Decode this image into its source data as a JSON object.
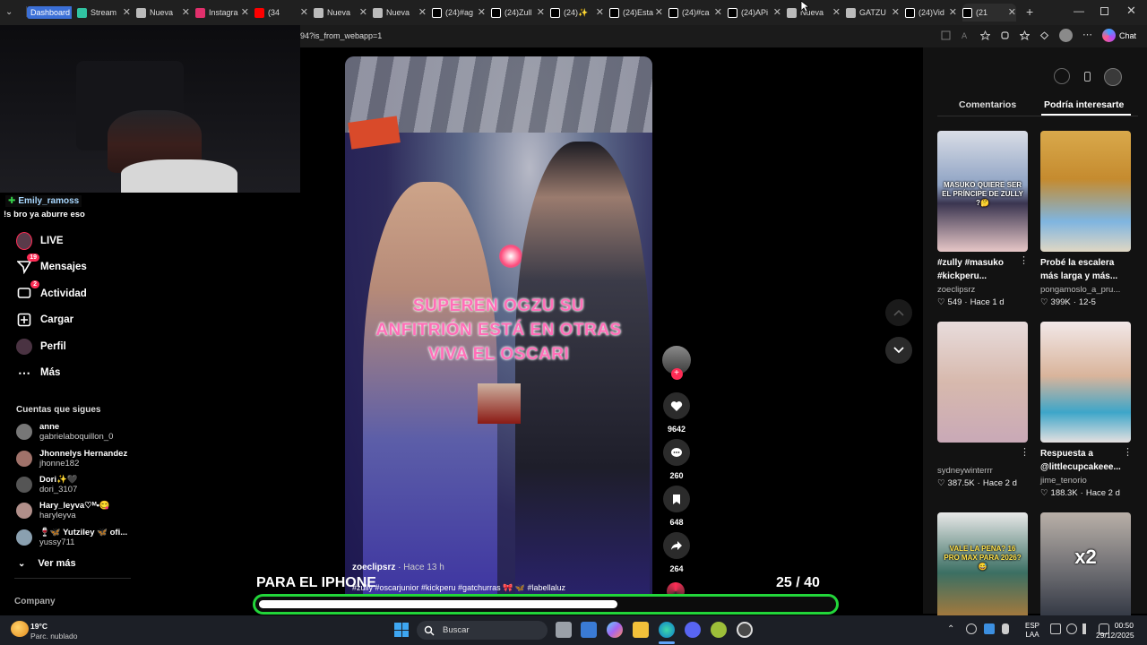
{
  "tabs": [
    {
      "label": "Dashboard",
      "icon": "dashboard-icon"
    },
    {
      "label": "Stream",
      "icon": "streamlabs-icon"
    },
    {
      "label": "Nueva",
      "icon": "page-icon"
    },
    {
      "label": "Instagra",
      "icon": "instagram-icon"
    },
    {
      "label": "(34",
      "icon": "youtube-icon"
    },
    {
      "label": "Nueva",
      "icon": "page-icon"
    },
    {
      "label": "Nueva",
      "icon": "page-icon"
    },
    {
      "label": "(24)#ag",
      "icon": "tiktok-icon"
    },
    {
      "label": "(24)Zull",
      "icon": "tiktok-icon"
    },
    {
      "label": "(24)✨",
      "icon": "tiktok-icon"
    },
    {
      "label": "(24)Esta",
      "icon": "tiktok-icon"
    },
    {
      "label": "(24)#ca",
      "icon": "tiktok-icon"
    },
    {
      "label": "(24)APi",
      "icon": "tiktok-icon"
    },
    {
      "label": "Nueva",
      "icon": "page-icon"
    },
    {
      "label": "GATZU",
      "icon": "page-icon"
    },
    {
      "label": "(24)Vid",
      "icon": "tiktok-icon"
    },
    {
      "label": "(21",
      "icon": "tiktok-icon"
    }
  ],
  "address": {
    "url": "94?is_from_webapp=1",
    "chat_label": "Chat"
  },
  "chat_overlay": {
    "user": "Emily_ramoss",
    "message": "!s bro ya aburre eso"
  },
  "nav": [
    {
      "label": "LIVE",
      "icon": "live-avatar-icon"
    },
    {
      "label": "Mensajes",
      "icon": "messages-icon",
      "badge": "19"
    },
    {
      "label": "Actividad",
      "icon": "activity-icon",
      "badge": "2"
    },
    {
      "label": "Cargar",
      "icon": "upload-icon"
    },
    {
      "label": "Perfil",
      "icon": "profile-icon"
    },
    {
      "label": "Más",
      "icon": "more-icon"
    }
  ],
  "following": {
    "heading": "Cuentas que sigues",
    "accounts": [
      {
        "name": "anne",
        "handle": "gabrielaboquillon_0"
      },
      {
        "name": "Jhonnelys Hernandez",
        "handle": "jhonne182"
      },
      {
        "name": "Dori✨🖤",
        "handle": "dori_3107"
      },
      {
        "name": "Hary_leyva♡ᴹ•😋",
        "handle": "haryleyva"
      },
      {
        "name": "🍷🦋 Yutziley 🦋 ofi...",
        "handle": "yussy711"
      }
    ],
    "see_more": "Ver más"
  },
  "footer_link": "Company",
  "video": {
    "caption_lines": [
      "SUPEREN OGZU SU",
      "ANFITRIÓN ESTÁ EN OTRAS",
      "VIVA EL OSCARI"
    ],
    "author": "zoeclipsrz",
    "time_ago": "Hace 13 h",
    "hashtags": "#zully #oscarjunior #kickperu #gatchurras 🎀 🦋 #labellaluz"
  },
  "actions": {
    "likes": "9642",
    "comments": "260",
    "saves": "648",
    "shares": "264"
  },
  "right_panel": {
    "tab_comments": "Comentarios",
    "tab_interest": "Podría interesarte",
    "items": [
      {
        "thumb_text": "MASUKO QUIERE SER EL PRÍNCIPE DE ZULLY ?🤔",
        "title": "#zully #masuko #kickperu...",
        "user": "zoeclipsrz",
        "likes": "549",
        "when": "Hace 1 d"
      },
      {
        "thumb_text": "",
        "title": "Probé la escalera más larga y más...",
        "user": "pongamoslo_a_pru...",
        "likes": "399K",
        "when": "12-5"
      },
      {
        "thumb_text": "",
        "title": "",
        "user": "sydneywinterrr",
        "likes": "387.5K",
        "when": "Hace 2 d"
      },
      {
        "thumb_text": "",
        "title": "Respuesta a @littlecupcakeee...",
        "user": "jime_tenorio",
        "likes": "188.3K",
        "when": "Hace 2 d"
      },
      {
        "thumb_text": "VALE LA PENA? 16 PRO MAX PARA 2026?😅",
        "title": "",
        "user": "",
        "likes": "",
        "when": ""
      },
      {
        "thumb_text": "x2",
        "title": "",
        "user": "",
        "likes": "",
        "when": ""
      }
    ]
  },
  "stream_overlay": {
    "label": "PARA EL IPHONE",
    "count": "25",
    "total": "/ 40",
    "progress": 0.625
  },
  "taskbar": {
    "weather_temp": "19°C",
    "weather_desc": "Parc. nublado",
    "search_placeholder": "Buscar",
    "lang": "ESP",
    "lang2": "LAA",
    "time": "00:50",
    "date": "29/12/2025"
  },
  "colors": {
    "accent": "#fe2c55",
    "overlay_green": "#22d63a",
    "caption_pink": "#ff6fb8"
  }
}
